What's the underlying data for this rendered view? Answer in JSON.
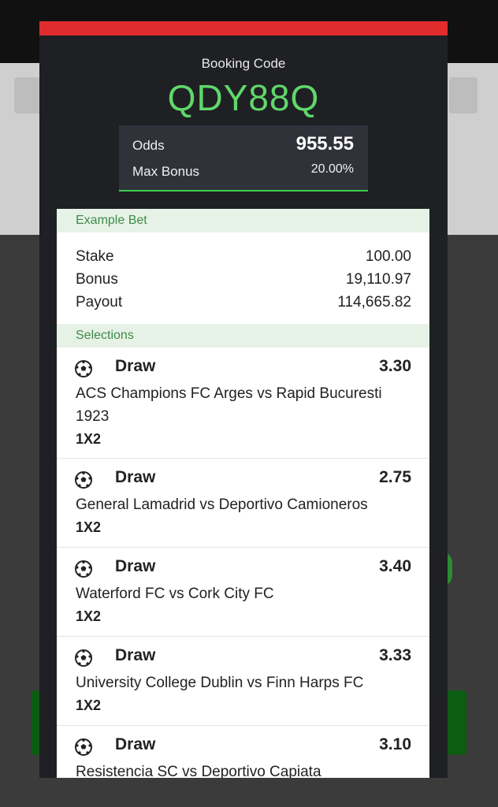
{
  "modal": {
    "booking_label": "Booking Code",
    "booking_code": "QDY88Q",
    "odds_label": "Odds",
    "odds_value": "955.55",
    "max_bonus_label": "Max Bonus",
    "max_bonus_value": "20.00%"
  },
  "example_bet": {
    "header": "Example Bet",
    "stake_label": "Stake",
    "stake_value": "100.00",
    "bonus_label": "Bonus",
    "bonus_value": "19,110.97",
    "payout_label": "Payout",
    "payout_value": "114,665.82"
  },
  "selections": {
    "header": "Selections",
    "items": [
      {
        "pick": "Draw",
        "odds": "3.30",
        "match_line1": "ACS Champions FC Arges vs Rapid Bucuresti",
        "match_line2": "1923",
        "market": "1X2"
      },
      {
        "pick": "Draw",
        "odds": "2.75",
        "match_line1": "General Lamadrid vs Deportivo Camioneros",
        "market": "1X2"
      },
      {
        "pick": "Draw",
        "odds": "3.40",
        "match_line1": "Waterford FC vs Cork City FC",
        "market": "1X2"
      },
      {
        "pick": "Draw",
        "odds": "3.33",
        "match_line1": "University College Dublin vs Finn Harps FC",
        "market": "1X2"
      },
      {
        "pick": "Draw",
        "odds": "3.10",
        "match_line1": "Resistencia SC vs Deportivo Capiata"
      }
    ]
  },
  "colors": {
    "accent_green": "#5fd86a",
    "top_bar_red": "#e02c2c",
    "section_green": "#3f8b4a"
  },
  "icons": {
    "selection": "soccer-ball-icon"
  }
}
